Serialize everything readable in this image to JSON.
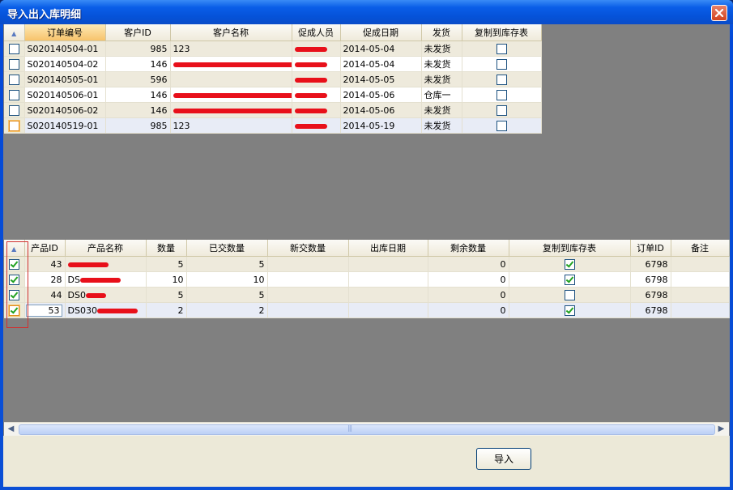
{
  "window": {
    "title": "导入出入库明细"
  },
  "orders": {
    "columns": [
      "订单编号",
      "客户ID",
      "客户名称",
      "促成人员",
      "促成日期",
      "发货",
      "复制到库存表"
    ],
    "rows": [
      {
        "order_no": "S020140504-01",
        "customer_id": "985",
        "customer_name": "123",
        "sales_date": "2014-05-04",
        "shipping": "未发货",
        "copy": false
      },
      {
        "order_no": "S020140504-02",
        "customer_id": "146",
        "customer_name": "",
        "sales_date": "2014-05-04",
        "shipping": "未发货",
        "copy": false
      },
      {
        "order_no": "S020140505-01",
        "customer_id": "596",
        "customer_name": "",
        "sales_date": "2014-05-05",
        "shipping": "未发货",
        "copy": false
      },
      {
        "order_no": "S020140506-01",
        "customer_id": "146",
        "customer_name": "",
        "sales_date": "2014-05-06",
        "shipping": "仓库一",
        "copy": false
      },
      {
        "order_no": "S020140506-02",
        "customer_id": "146",
        "customer_name": "",
        "sales_date": "2014-05-06",
        "shipping": "未发货",
        "copy": false
      },
      {
        "order_no": "S020140519-01",
        "customer_id": "985",
        "customer_name": "123",
        "sales_date": "2014-05-19",
        "shipping": "未发货",
        "copy": false
      }
    ]
  },
  "products": {
    "columns": [
      "产品ID",
      "产品名称",
      "数量",
      "已交数量",
      "新交数量",
      "出库日期",
      "剩余数量",
      "复制到库存表",
      "订单ID",
      "备注"
    ],
    "rows": [
      {
        "checked": true,
        "product_id": "43",
        "product_name": "",
        "qty": "5",
        "delivered": "5",
        "remaining": "0",
        "copy": true,
        "order_id": "6798"
      },
      {
        "checked": true,
        "product_id": "28",
        "product_name": "DS",
        "qty": "10",
        "delivered": "10",
        "remaining": "0",
        "copy": true,
        "order_id": "6798"
      },
      {
        "checked": true,
        "product_id": "44",
        "product_name": "DS0",
        "qty": "5",
        "delivered": "5",
        "remaining": "0",
        "copy": false,
        "order_id": "6798"
      },
      {
        "checked": true,
        "product_id": "53",
        "product_name": "DS030",
        "qty": "2",
        "delivered": "2",
        "remaining": "0",
        "copy": true,
        "order_id": "6798"
      }
    ]
  },
  "footer": {
    "import_label": "导入"
  },
  "icons": {
    "close": "close-icon",
    "sort": "sort-icon",
    "scroll_left": "scroll-left-icon",
    "scroll_right": "scroll-right-icon"
  },
  "colors": {
    "title_bar": "#0a5ee8",
    "grid_back": "#808080",
    "selected_header": "#f7c36b",
    "redaction": "#e8101a",
    "annotation_box": "#d03030"
  }
}
